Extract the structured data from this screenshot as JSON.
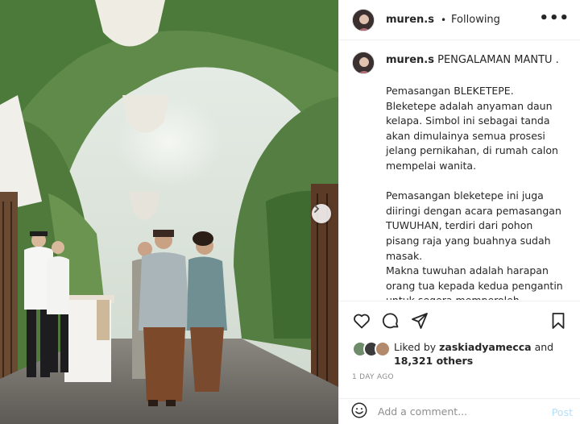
{
  "post": {
    "username": "muren.s",
    "separator": "•",
    "follow_status": "Following",
    "more_label": "•••"
  },
  "caption": {
    "username": "muren.s",
    "title": "PENGALAMAN MANTU .",
    "body": "Pemasangan BLEKETEPE.\nBleketepe adalah anyaman daun kelapa. Simbol ini sebagai tanda akan dimulainya semua prosesi jelang pernikahan, di rumah calon mempelai wanita.\n\nPemasangan bleketepe ini juga diiringi dengan acara pemasangan TUWUHAN, terdiri dari pohon pisang raja yang buahnya sudah masak.\nMakna tuwuhan adalah harapan orang tua kepada kedua pengantin untuk segera memperoleh keturunan.\nPilihan pisang raja memiliki filosofi bahwa pasangan pengantin kelak memiliki kemakmuran dan kemuliaan"
  },
  "actions": {
    "like_icon": "heart-icon",
    "comment_icon": "comment-icon",
    "share_icon": "paper-plane-icon",
    "save_icon": "bookmark-icon"
  },
  "likes": {
    "prefix": "Liked by ",
    "first_user": "zaskiadyamecca",
    "middle": " and",
    "count": "18,321 others"
  },
  "date": "1 DAY AGO",
  "comment": {
    "placeholder": "Add a comment...",
    "post_label": "Post",
    "emoji_icon": "smiley-icon"
  },
  "colors": {
    "link_blue_disabled": "#b2dffc",
    "muted_gray": "#8e8e8e",
    "text": "#262626",
    "border": "#efefef"
  }
}
